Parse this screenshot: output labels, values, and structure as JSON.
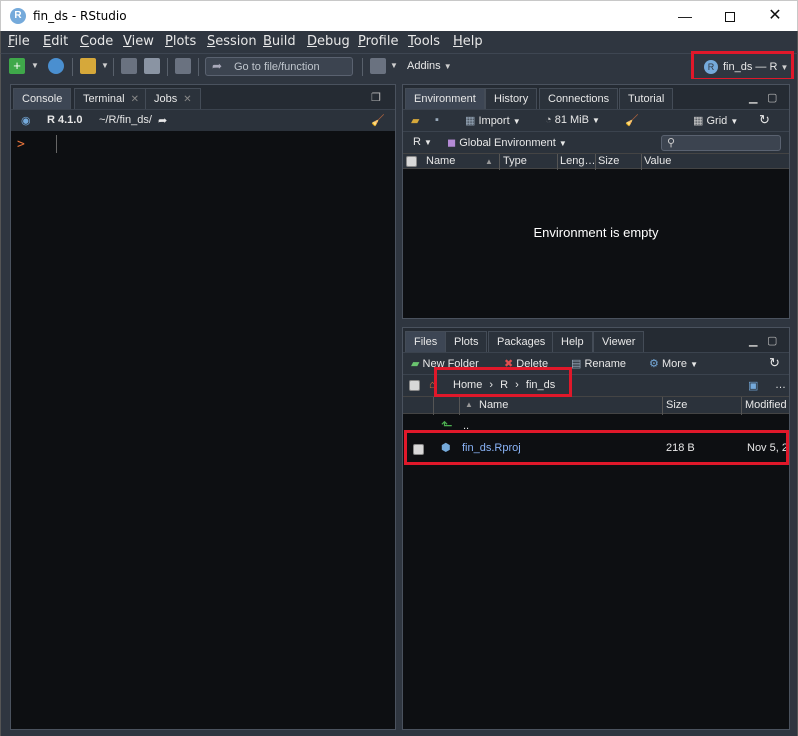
{
  "window": {
    "title": "fin_ds - RStudio",
    "app_icon": "R",
    "minimize": "—",
    "close": "✕"
  },
  "menu": [
    "File",
    "Edit",
    "Code",
    "View",
    "Plots",
    "Session",
    "Build",
    "Debug",
    "Profile",
    "Tools",
    "Help"
  ],
  "toolbar": {
    "goto_placeholder": "Go to file/function",
    "addins_label": "Addins",
    "project_label": "fin_ds — R"
  },
  "console_pane": {
    "tabs": [
      "Console",
      "Terminal",
      "Jobs"
    ],
    "r_version": "R 4.1.0",
    "path": "~/R/fin_ds/",
    "prompt": ">"
  },
  "env_pane": {
    "tabs": [
      "Environment",
      "History",
      "Connections",
      "Tutorial"
    ],
    "import_label": "Import",
    "memory_label": "81 MiB",
    "grid_label": "Grid",
    "r_label": "R",
    "scope_label": "Global Environment",
    "columns": [
      "Name",
      "Type",
      "Leng…",
      "Size",
      "Value"
    ],
    "empty_message": "Environment is empty"
  },
  "files_pane": {
    "tabs": [
      "Files",
      "Plots",
      "Packages",
      "Help",
      "Viewer"
    ],
    "new_folder_label": "New Folder",
    "delete_label": "Delete",
    "rename_label": "Rename",
    "more_label": "More",
    "breadcrumb": [
      "Home",
      "R",
      "fin_ds"
    ],
    "columns": [
      "Name",
      "Size",
      "Modified"
    ],
    "up_dir": "..",
    "files": [
      {
        "name": "fin_ds.Rproj",
        "size": "218 B",
        "modified": "Nov 5, 2"
      }
    ],
    "ellipsis": "…"
  },
  "colors": {
    "chrome": "#2f3640",
    "pane_bg": "#0d0f12",
    "highlight": "#e0182a",
    "r_blue": "#75aadb",
    "prompt": "#e8743b"
  }
}
